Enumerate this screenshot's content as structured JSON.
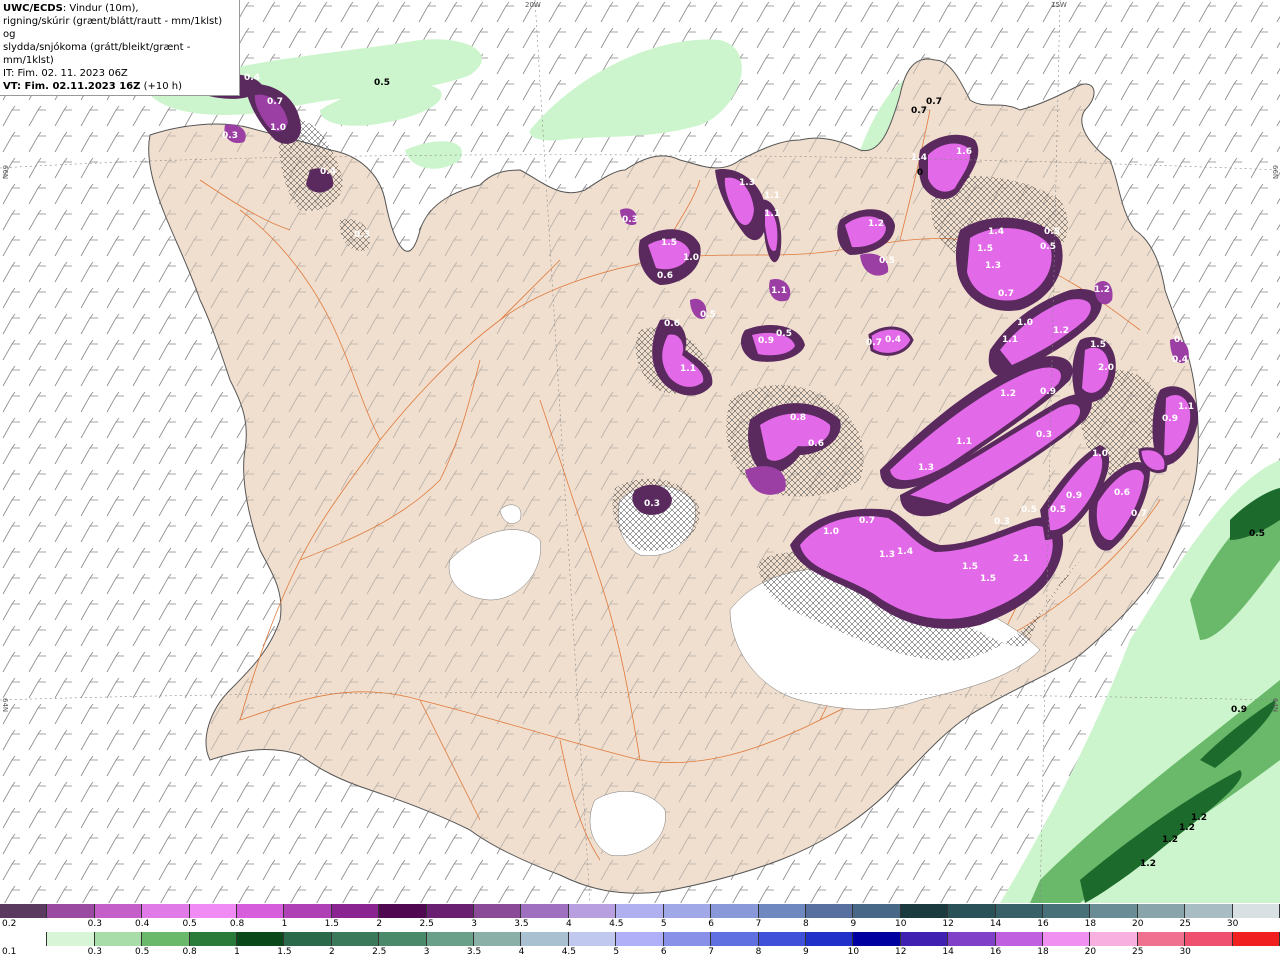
{
  "info": {
    "product": "UWC/ECDS",
    "desc_line1": ": Vindur (10m),",
    "desc_line2": "rigning/skúrir (grænt/blátt/rautt - mm/1klst) og",
    "desc_line3": "slydda/snjókoma (grátt/bleikt/grænt - mm/1klst)",
    "issue_time": "IT: Fim. 02. 11. 2023 06Z",
    "valid_time": "VT: Fim. 02.11.2023 16Z",
    "lead": "(+10 h)"
  },
  "graticule": {
    "lon_labels": [
      "20W",
      "15W"
    ],
    "lat_labels": [
      "66N",
      "64N",
      "66N",
      "64N"
    ]
  },
  "colors": {
    "land": "#f0dfcf",
    "land_border": "#555555",
    "roads": "#e0793a",
    "snow_dark": "#5a2a5e",
    "snow_mid": "#9b3fa5",
    "snow_light": "#e26ae8",
    "rain_light": "#cdf5cd",
    "rain_mid": "#6ab86a",
    "rain_dark": "#1c6a2c",
    "glacier": "#ffffff"
  },
  "precip_labels": {
    "snow": [
      {
        "t": "0.6"
      },
      {
        "t": "0.4"
      },
      {
        "t": "0.7"
      },
      {
        "t": "1.0"
      },
      {
        "t": "0.3"
      },
      {
        "t": "0.4"
      },
      {
        "t": "0.3"
      },
      {
        "t": "0.3"
      },
      {
        "t": "1.5"
      },
      {
        "t": "1.0"
      },
      {
        "t": "0.6"
      },
      {
        "t": "0.5"
      },
      {
        "t": "1.3"
      },
      {
        "t": "1.1"
      },
      {
        "t": "1.1"
      },
      {
        "t": "1.1"
      },
      {
        "t": "1.2"
      },
      {
        "t": "0.5"
      },
      {
        "t": "1.4"
      },
      {
        "t": "1.6"
      },
      {
        "t": "1.4"
      },
      {
        "t": "0.5"
      },
      {
        "t": "1.5"
      },
      {
        "t": "1.3"
      },
      {
        "t": "0.5"
      },
      {
        "t": "0.7"
      },
      {
        "t": "0.6"
      },
      {
        "t": "1.1"
      },
      {
        "t": "0.9"
      },
      {
        "t": "0.5"
      },
      {
        "t": "0.7"
      },
      {
        "t": "0.4"
      },
      {
        "t": "1.2"
      },
      {
        "t": "1.0"
      },
      {
        "t": "1.1"
      },
      {
        "t": "1.2"
      },
      {
        "t": "1.5"
      },
      {
        "t": "2.0"
      },
      {
        "t": "0.4"
      },
      {
        "t": "0.4"
      },
      {
        "t": "1.2"
      },
      {
        "t": "0.9"
      },
      {
        "t": "0.3"
      },
      {
        "t": "0.8"
      },
      {
        "t": "0.6"
      },
      {
        "t": "1.1"
      },
      {
        "t": "1.0"
      },
      {
        "t": "1.3"
      },
      {
        "t": "0.9"
      },
      {
        "t": "1.1"
      },
      {
        "t": "0.9"
      },
      {
        "t": "0.6"
      },
      {
        "t": "0.5"
      },
      {
        "t": "0.7"
      },
      {
        "t": "0.3"
      },
      {
        "t": "0.5"
      },
      {
        "t": "1.0"
      },
      {
        "t": "0.7"
      },
      {
        "t": "1.3"
      },
      {
        "t": "1.4"
      },
      {
        "t": "1.5"
      },
      {
        "t": "1.5"
      },
      {
        "t": "2.1"
      },
      {
        "t": "0.3"
      }
    ],
    "rain": [
      {
        "t": "0.5"
      },
      {
        "t": "0.7"
      },
      {
        "t": "0.7"
      },
      {
        "t": "0"
      },
      {
        "t": "0.5"
      },
      {
        "t": "0.9"
      },
      {
        "t": "1.2"
      },
      {
        "t": "1.2"
      },
      {
        "t": "1.2"
      },
      {
        "t": "1.2"
      }
    ]
  },
  "legend_snow": {
    "colors": [
      "#5a3a5e",
      "#9a4aa0",
      "#c45fca",
      "#e07ae6",
      "#f08af4",
      "#d65edc",
      "#b040b6",
      "#8a2490",
      "#500850",
      "#6a2070",
      "#8a4a98",
      "#a070c0",
      "#b8a0e0",
      "#b0b0f0",
      "#a0a8e8",
      "#8898d8",
      "#7088c0",
      "#5870a0",
      "#486888",
      "#1a3a40",
      "#2a5058",
      "#386068",
      "#487078",
      "#6a8c94",
      "#8aa4ac",
      "#a8bcc4",
      "#d8e0e4"
    ],
    "labels": [
      "0.2",
      "0.3",
      "0.4",
      "0.5",
      "0.8",
      "1",
      "1.5",
      "2",
      "2.5",
      "3",
      "3.5",
      "4",
      "4.5",
      "5",
      "6",
      "7",
      "8",
      "9",
      "10",
      "12",
      "14",
      "16",
      "18",
      "20",
      "25",
      "30"
    ]
  },
  "legend_rain": {
    "colors": [
      "#ffffff",
      "#d8f5d8",
      "#a8dca8",
      "#6ab86a",
      "#2a7a3a",
      "#0a4a1a",
      "#2a6a4a",
      "#3a7a5a",
      "#4a8a6a",
      "#6aa08a",
      "#8ab0a8",
      "#a8c0d0",
      "#c0c8f0",
      "#b0b0f8",
      "#8890e8",
      "#6070e0",
      "#4050d8",
      "#2030c8",
      "#0000a0",
      "#4020b0",
      "#8040c8",
      "#c060e0",
      "#f090f0",
      "#f8b0e0",
      "#f07090",
      "#f05070",
      "#f02020"
    ],
    "labels": [
      "0.1",
      "0.3",
      "0.5",
      "0.8",
      "1",
      "1.5",
      "2",
      "2.5",
      "3",
      "3.5",
      "4",
      "4.5",
      "5",
      "6",
      "7",
      "8",
      "9",
      "10",
      "12",
      "14",
      "16",
      "18",
      "20",
      "25",
      "30"
    ]
  }
}
